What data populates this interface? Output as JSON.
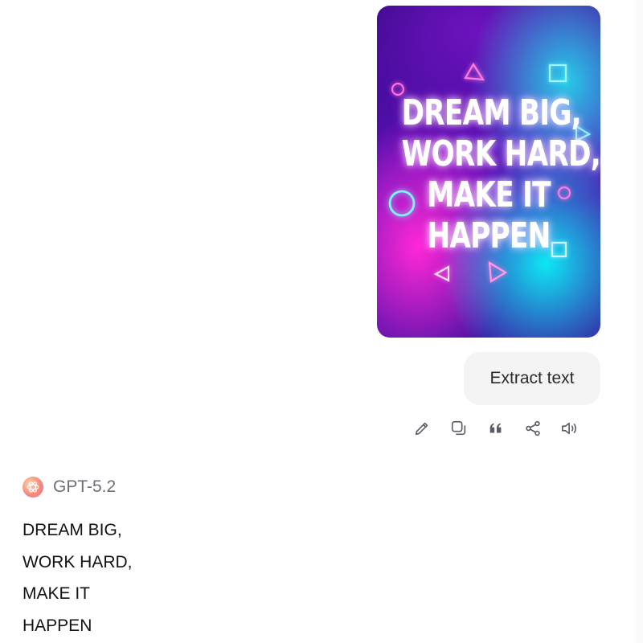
{
  "user_message": {
    "image": {
      "poster_lines": [
        "DREAM BIG,",
        "WORK HARD,",
        "MAKE IT",
        "HAPPEN"
      ],
      "colors": {
        "background": "#4a10a8",
        "cyan_glow": "#18dcec",
        "magenta_glow": "#ff2ad6",
        "neon_pink": "#ff6fd8",
        "neon_cyan": "#6ff4ff"
      }
    },
    "text": "Extract text"
  },
  "message_actions": [
    {
      "name": "edit-icon",
      "label": "Edit"
    },
    {
      "name": "copy-icon",
      "label": "Copy"
    },
    {
      "name": "quote-icon",
      "label": "Quote"
    },
    {
      "name": "share-icon",
      "label": "Share"
    },
    {
      "name": "speaker-icon",
      "label": "Read aloud"
    }
  ],
  "assistant": {
    "model_name": "GPT-5.2",
    "logo_icon": "openai-logo-icon",
    "response_lines": [
      "DREAM BIG,",
      "WORK HARD,",
      "MAKE IT",
      "HAPPEN"
    ]
  },
  "theme": {
    "icon_color": "#5c5c66",
    "bubble_bg": "#f4f4f4"
  }
}
